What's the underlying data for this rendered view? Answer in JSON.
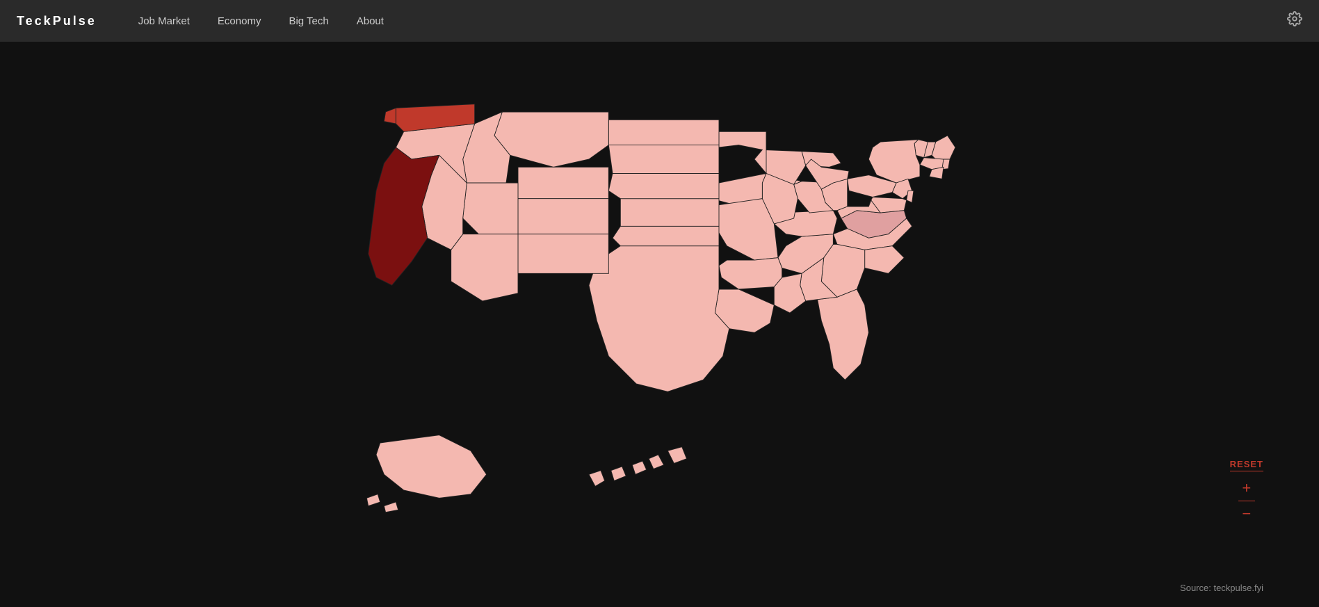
{
  "header": {
    "logo": "TeckPulse",
    "nav": [
      {
        "label": "Job Market",
        "id": "job-market"
      },
      {
        "label": "Economy",
        "id": "economy"
      },
      {
        "label": "Big Tech",
        "id": "big-tech"
      },
      {
        "label": "About",
        "id": "about"
      }
    ]
  },
  "controls": {
    "reset": "RESET",
    "zoom_in": "+",
    "zoom_out": "−"
  },
  "source": "Source: teckpulse.fyi",
  "colors": {
    "default": "#f4b8b0",
    "light": "#f9d0cb",
    "medium": "#e87060",
    "dark_red": "#8b1a1a",
    "washington": "#c0392b",
    "california": "#7b1010",
    "virginia": "#dda0a0"
  }
}
